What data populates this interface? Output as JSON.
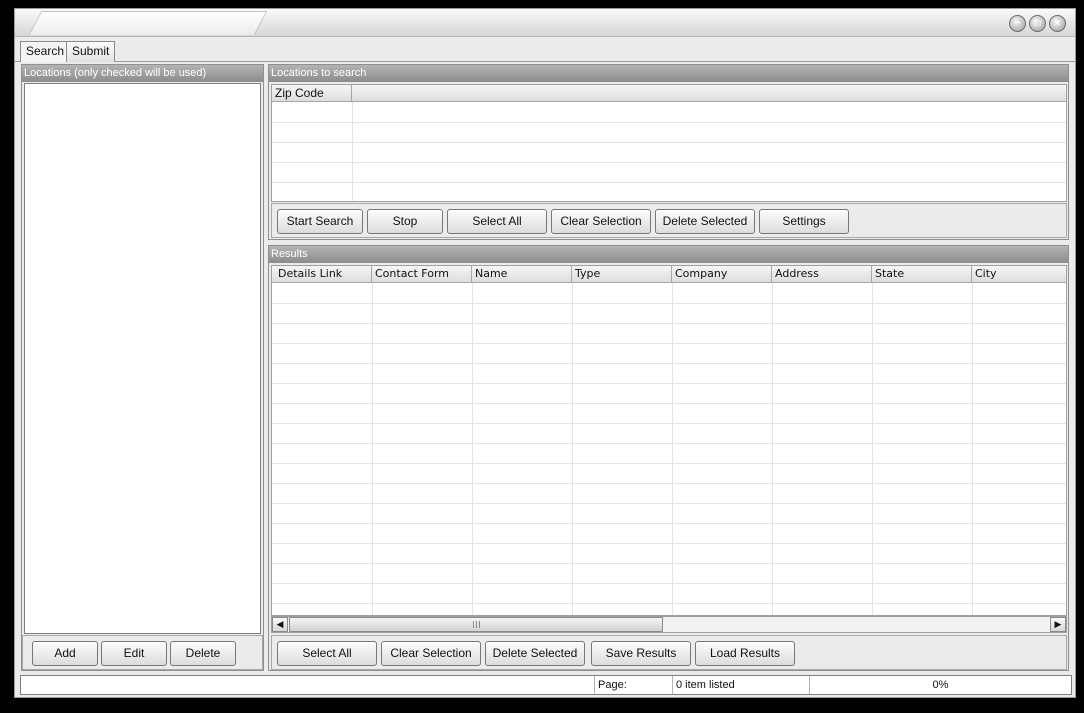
{
  "window": {
    "title": ""
  },
  "tabs": [
    {
      "label": "Search",
      "selected": true
    },
    {
      "label": "Submit",
      "selected": false
    }
  ],
  "locations_panel": {
    "title": "Locations (only checked will be used)",
    "buttons": {
      "add": "Add",
      "edit": "Edit",
      "delete": "Delete"
    }
  },
  "locations_search_panel": {
    "title": "Locations to search",
    "columns": [
      "Zip Code",
      ""
    ],
    "buttons": {
      "start_search": "Start Search",
      "stop": "Stop",
      "select_all": "Select All",
      "clear_selection": "Clear Selection",
      "delete_selected": "Delete Selected",
      "settings": "Settings"
    }
  },
  "results_panel": {
    "title": "Results",
    "columns": [
      "Details Link",
      "Contact Form",
      "Name",
      "Type",
      "Company",
      "Address",
      "State",
      "City"
    ],
    "buttons": {
      "select_all": "Select All",
      "clear_selection": "Clear Selection",
      "delete_selected": "Delete Selected",
      "save_results": "Save Results",
      "load_results": "Load Results"
    }
  },
  "status": {
    "page_label": "Page:",
    "items": "0 item listed",
    "progress": "0%"
  }
}
